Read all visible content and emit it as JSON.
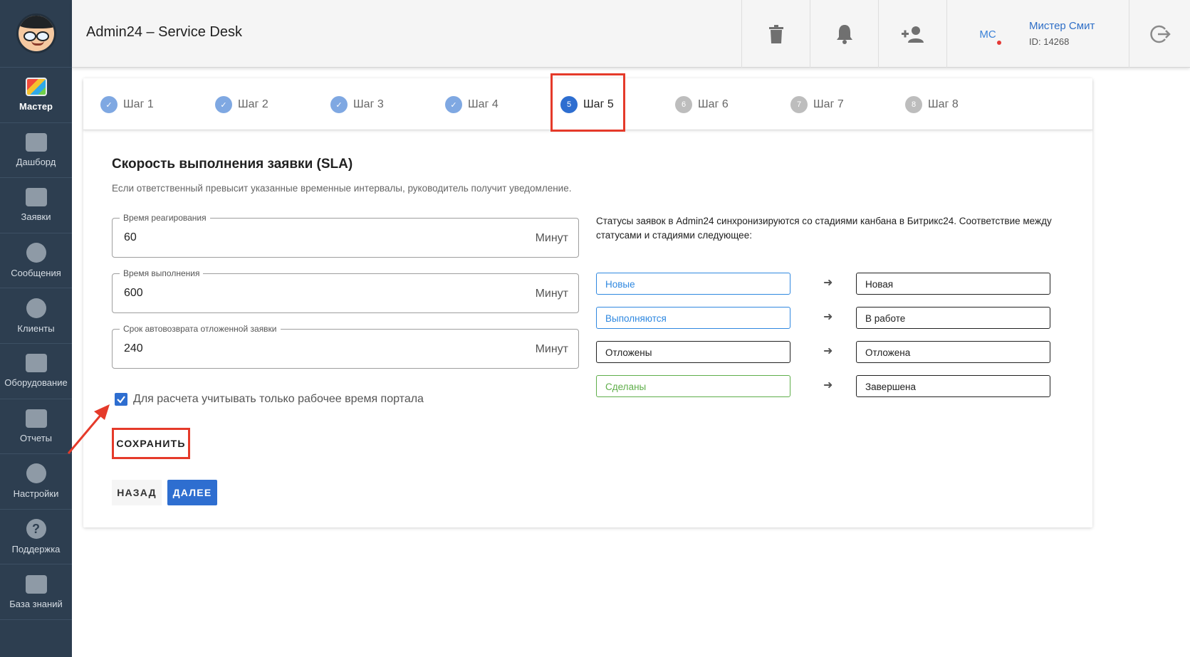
{
  "app": {
    "title": "Admin24 – Service Desk"
  },
  "sidebar": {
    "items": [
      {
        "label": "Мастер",
        "icon": "wizard-icon",
        "active": true
      },
      {
        "label": "Дашборд",
        "icon": "dashboard-icon"
      },
      {
        "label": "Заявки",
        "icon": "megaphone-icon"
      },
      {
        "label": "Сообщения",
        "icon": "chat-icon"
      },
      {
        "label": "Клиенты",
        "icon": "clients-icon"
      },
      {
        "label": "Оборудование",
        "icon": "equipment-icon"
      },
      {
        "label": "Отчеты",
        "icon": "reports-icon"
      },
      {
        "label": "Настройки",
        "icon": "gear-icon"
      },
      {
        "label": "Поддержка",
        "icon": "help-icon"
      },
      {
        "label": "База знаний",
        "icon": "knowledge-base-icon"
      }
    ]
  },
  "header": {
    "user": {
      "initials": "МС",
      "name": "Мистер Смит",
      "id": "ID: 14268"
    }
  },
  "stepper": {
    "steps": [
      {
        "label": "Шаг 1",
        "num": "1",
        "state": "done"
      },
      {
        "label": "Шаг 2",
        "num": "2",
        "state": "done"
      },
      {
        "label": "Шаг 3",
        "num": "3",
        "state": "done"
      },
      {
        "label": "Шаг 4",
        "num": "4",
        "state": "done"
      },
      {
        "label": "Шаг 5",
        "num": "5",
        "state": "current"
      },
      {
        "label": "Шаг 6",
        "num": "6",
        "state": "todo"
      },
      {
        "label": "Шаг 7",
        "num": "7",
        "state": "todo"
      },
      {
        "label": "Шаг 8",
        "num": "8",
        "state": "todo"
      }
    ]
  },
  "sla": {
    "title": "Скорость выполнения заявки (SLA)",
    "description": "Если ответственный превысит указанные временные интервалы, руководитель получит уведомление.",
    "fields": [
      {
        "label": "Время реагирования",
        "value": "60",
        "unit": "Минут"
      },
      {
        "label": "Время выполнения",
        "value": "600",
        "unit": "Минут"
      },
      {
        "label": "Срок автовозврата отложенной заявки",
        "value": "240",
        "unit": "Минут"
      }
    ],
    "checkbox_label": "Для расчета учитывать только рабочее время портала",
    "checkbox_checked": true,
    "save_label": "СОХРАНИТЬ",
    "back_label": "НАЗАД",
    "next_label": "ДАЛЕЕ"
  },
  "statuses": {
    "text": "Статусы заявок в Admin24 синхронизируются со стадиями канбана в Битрикс24. Соответствие между статусами и стадиями следующее:",
    "rows": [
      {
        "status": "Новые",
        "stage": "Новая",
        "color": "#2f88e0"
      },
      {
        "status": "Выполняются",
        "stage": "В работе",
        "color": "#2f88e0"
      },
      {
        "status": "Отложены",
        "stage": "Отложена",
        "color": "#212121"
      },
      {
        "status": "Сделаны",
        "stage": "Завершена",
        "color": "#5fae4a"
      }
    ]
  },
  "colors": {
    "accent": "#2e6ed0",
    "sidebar": "#2d3e50",
    "annotation": "#e53a2a"
  }
}
